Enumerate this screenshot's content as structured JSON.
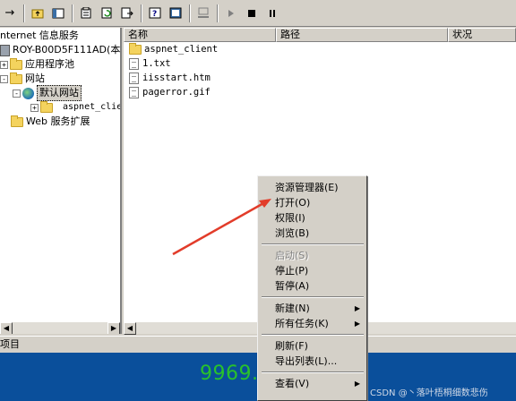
{
  "toolbar": {
    "icons": [
      "back-arrow-icon",
      "up-folder-icon",
      "show-tree-icon",
      "properties-icon",
      "refresh-icon",
      "export-icon",
      "help-icon",
      "view-icon",
      "computer-icon",
      "play-icon",
      "stop-icon",
      "pause-icon"
    ]
  },
  "tree": {
    "root_label": "nternet 信息服务",
    "server_label": "ROY-B00D5F111AD(本地计",
    "app_pools_label": "应用程序池",
    "websites_label": "网站",
    "default_site_label": "默认网站",
    "aspnet_label": "aspnet_clien",
    "web_ext_label": "Web 服务扩展"
  },
  "list": {
    "columns": [
      "名称",
      "路径",
      "状况"
    ],
    "rows": [
      {
        "name": "aspnet_client",
        "type": "folder"
      },
      {
        "name": "1.txt",
        "type": "file"
      },
      {
        "name": "iisstart.htm",
        "type": "file"
      },
      {
        "name": "pagerror.gif",
        "type": "file"
      }
    ]
  },
  "status": {
    "text": "项目"
  },
  "context_menu": {
    "explore": "资源管理器(E)",
    "open": "打开(O)",
    "permissions": "权限(I)",
    "browse": "浏览(B)",
    "start": "启动(S)",
    "stop": "停止(P)",
    "pause": "暂停(A)",
    "new": "新建(N)",
    "all_tasks": "所有任务(K)",
    "refresh": "刷新(F)",
    "export": "导出列表(L)...",
    "view": "查看(V)"
  },
  "watermark": "9969.net",
  "credit": "CSDN @丶落叶梧桐细数悲伤"
}
